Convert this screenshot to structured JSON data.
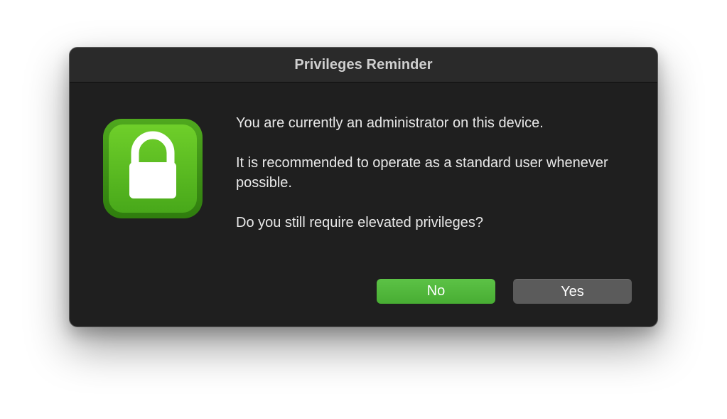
{
  "dialog": {
    "title": "Privileges Reminder",
    "icon": "lock-icon",
    "message": {
      "line1": "You are currently an administrator on this device.",
      "line2": "It is recommended to operate as a standard user whenever possible.",
      "line3": "Do you still require elevated privileges?"
    },
    "buttons": {
      "no_label": "No",
      "yes_label": "Yes"
    }
  },
  "colors": {
    "accent": "#4fb53a",
    "window_bg": "#1f1f1f",
    "titlebar_bg": "#2a2a2a",
    "secondary_button": "#5b5b5b"
  }
}
